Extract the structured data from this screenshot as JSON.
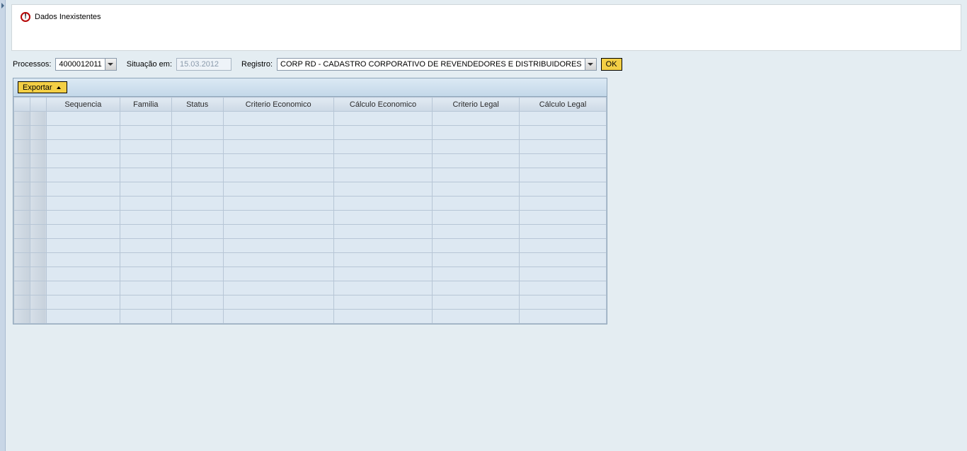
{
  "message": {
    "text": "Dados Inexistentes"
  },
  "filters": {
    "processos_label": "Processos:",
    "processos_value": "4000012011",
    "situacao_label": "Situação em:",
    "situacao_value": "15.03.2012",
    "registro_label": "Registro:",
    "registro_value": "CORP RD - CADASTRO CORPORATIVO DE REVENDEDORES E DISTRIBUIDORES",
    "ok_label": "OK"
  },
  "toolbar": {
    "export_label": "Exportar"
  },
  "grid": {
    "columns": [
      "Sequencia",
      "Familia",
      "Status",
      "Criterio Economico",
      "Cálculo Economico",
      "Criterio Legal",
      "Cálculo Legal"
    ],
    "empty_rows": 15
  }
}
